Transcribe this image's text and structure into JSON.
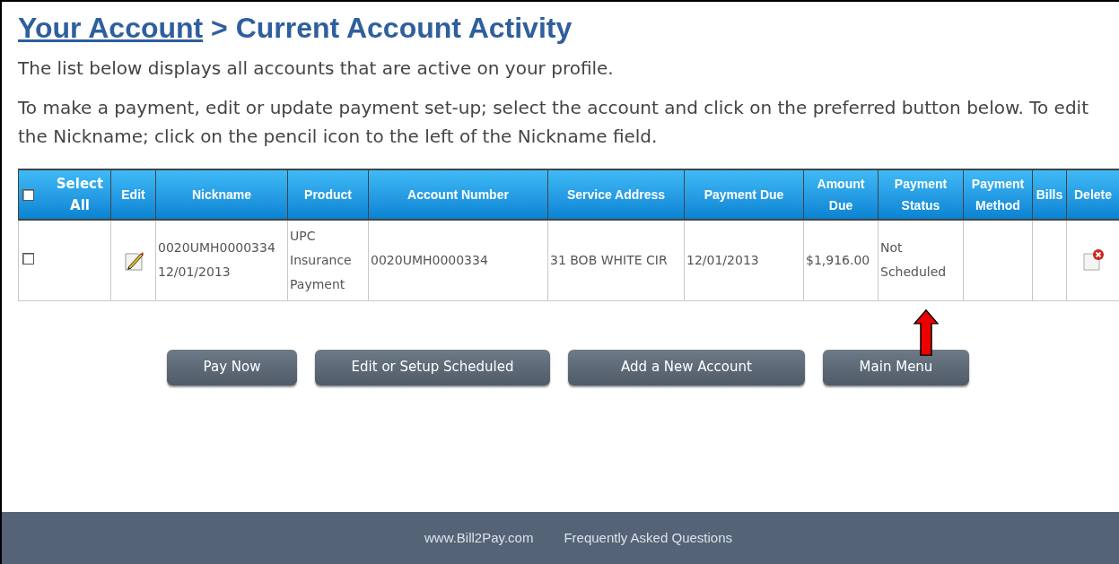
{
  "heading": {
    "link": "Your Account",
    "separator": ">",
    "title": "Current Account Activity"
  },
  "paragraphs": [
    "The list below displays all accounts that are active on your profile.",
    "To make a payment, edit or update payment set-up; select the account and click on the preferred button below. To edit the Nickname; click on the pencil icon to the left of the Nickname field."
  ],
  "table": {
    "select_all": {
      "label": "Select All",
      "checked": false
    },
    "columns": [
      "Edit",
      "Nickname",
      "Product",
      "Account Number",
      "Service Address",
      "Payment Due",
      "Amount Due",
      "Payment Status",
      "Payment Method",
      "Bills",
      "Delete"
    ],
    "rows": [
      {
        "checked": false,
        "nickname": [
          "0020UMH0000334",
          "12/01/2013"
        ],
        "product": "UPC Insurance Payment",
        "account_number": "0020UMH0000334",
        "service_address": "31 BOB WHITE CIR",
        "payment_due": "12/01/2013",
        "amount_due": "$1,916.00",
        "payment_status": "Not Scheduled"
      }
    ]
  },
  "buttons": [
    "Pay Now",
    "Edit or Setup Scheduled",
    "Add a New Account",
    "Main Menu"
  ],
  "footer": [
    "www.Bill2Pay.com",
    "Frequently Asked Questions"
  ]
}
